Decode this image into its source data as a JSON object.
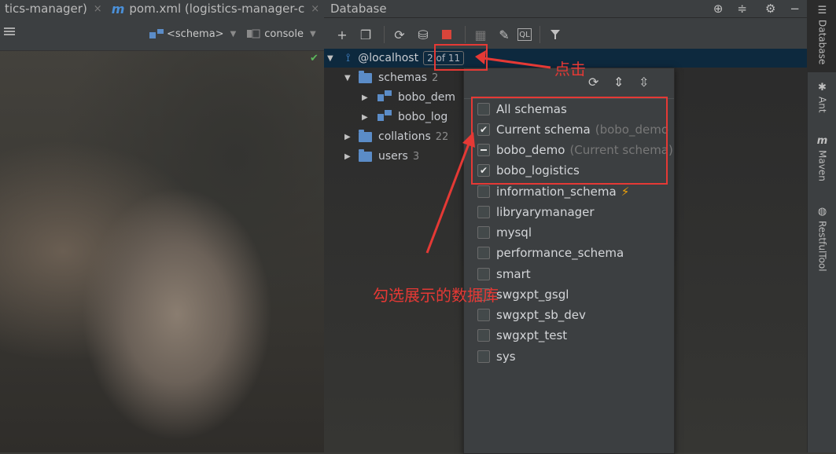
{
  "editor": {
    "tabs": [
      {
        "label": "tics-manager)",
        "close": "×"
      },
      {
        "label": "pom.xml (logistics-manager-c",
        "close": "×"
      }
    ],
    "tabs_chevron": "∨",
    "schema_combo": "<schema>",
    "console_combo": "console"
  },
  "db": {
    "title": "Database",
    "tree": {
      "localhost": {
        "label": "@localhost",
        "badge": "2 of 11"
      },
      "schemas": {
        "label": "schemas",
        "count": "2"
      },
      "schema_items": [
        "bobo_dem",
        "bobo_log"
      ],
      "collations": {
        "label": "collations",
        "count": "22"
      },
      "users": {
        "label": "users",
        "count": "3"
      }
    }
  },
  "popup": {
    "options": [
      {
        "label": "All schemas",
        "hint": "",
        "state": "unchecked"
      },
      {
        "label": "Current schema",
        "hint": "(bobo_demo",
        "state": "checked"
      },
      {
        "label": "bobo_demo",
        "hint": "(Current schema)",
        "state": "indeterminate"
      },
      {
        "label": "bobo_logistics",
        "hint": "",
        "state": "checked"
      },
      {
        "label": "information_schema",
        "hint": "",
        "state": "unchecked",
        "bolt": true
      },
      {
        "label": "libryarymanager",
        "hint": "",
        "state": "unchecked"
      },
      {
        "label": "mysql",
        "hint": "",
        "state": "unchecked"
      },
      {
        "label": "performance_schema",
        "hint": "",
        "state": "unchecked"
      },
      {
        "label": "smart",
        "hint": "",
        "state": "unchecked"
      },
      {
        "label": "swgxpt_gsgl",
        "hint": "",
        "state": "unchecked"
      },
      {
        "label": "swgxpt_sb_dev",
        "hint": "",
        "state": "unchecked"
      },
      {
        "label": "swgxpt_test",
        "hint": "",
        "state": "unchecked"
      },
      {
        "label": "sys",
        "hint": "",
        "state": "unchecked"
      }
    ]
  },
  "sidebar": {
    "tabs": [
      "Database",
      "Ant",
      "Maven",
      "RestfulTool"
    ]
  },
  "annotations": {
    "click": "点击",
    "select": "勾选展示的数据库"
  },
  "colors": {
    "annotation": "#e53935",
    "selection": "#0d293e",
    "folder": "#5b8cc7"
  }
}
